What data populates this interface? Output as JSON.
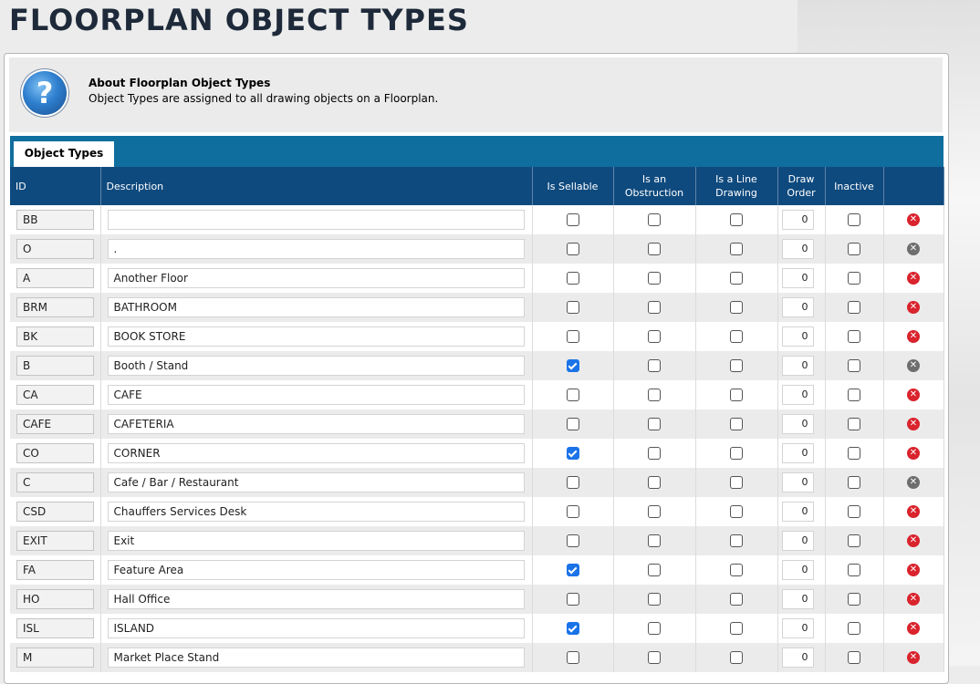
{
  "page": {
    "title": "FLOORPLAN OBJECT TYPES"
  },
  "info": {
    "title": "About Floorplan Object Types",
    "text": "Object Types are assigned to all drawing objects on a Floorplan.",
    "icon": "help-icon"
  },
  "tabs": [
    {
      "label": "Object Types",
      "active": true
    }
  ],
  "colors": {
    "tabbar": "#0f6e9e",
    "header": "#0f4a7e",
    "checked": "#1a73e8",
    "delete": "#d9232d",
    "delete_disabled": "#6e6e6e"
  },
  "table": {
    "columns": {
      "id": "ID",
      "description": "Description",
      "is_sellable": "Is Sellable",
      "is_obstruction_1": "Is an",
      "is_obstruction_2": "Obstruction",
      "is_line_1": "Is a Line",
      "is_line_2": "Drawing",
      "draw_order_1": "Draw",
      "draw_order_2": "Order",
      "inactive": "Inactive"
    },
    "rows": [
      {
        "id": "BB",
        "description": "",
        "sellable": false,
        "obstruction": false,
        "line": false,
        "order": "0",
        "inactive": false,
        "deletable": true
      },
      {
        "id": "O",
        "description": ".",
        "sellable": false,
        "obstruction": false,
        "line": false,
        "order": "0",
        "inactive": false,
        "deletable": false
      },
      {
        "id": "A",
        "description": "Another Floor",
        "sellable": false,
        "obstruction": false,
        "line": false,
        "order": "0",
        "inactive": false,
        "deletable": true
      },
      {
        "id": "BRM",
        "description": "BATHROOM",
        "sellable": false,
        "obstruction": false,
        "line": false,
        "order": "0",
        "inactive": false,
        "deletable": true
      },
      {
        "id": "BK",
        "description": "BOOK STORE",
        "sellable": false,
        "obstruction": false,
        "line": false,
        "order": "0",
        "inactive": false,
        "deletable": true
      },
      {
        "id": "B",
        "description": "Booth / Stand",
        "sellable": true,
        "obstruction": false,
        "line": false,
        "order": "0",
        "inactive": false,
        "deletable": false
      },
      {
        "id": "CA",
        "description": "CAFE",
        "sellable": false,
        "obstruction": false,
        "line": false,
        "order": "0",
        "inactive": false,
        "deletable": true
      },
      {
        "id": "CAFE",
        "description": "CAFETERIA",
        "sellable": false,
        "obstruction": false,
        "line": false,
        "order": "0",
        "inactive": false,
        "deletable": true
      },
      {
        "id": "CO",
        "description": "CORNER",
        "sellable": true,
        "obstruction": false,
        "line": false,
        "order": "0",
        "inactive": false,
        "deletable": true
      },
      {
        "id": "C",
        "description": "Cafe / Bar / Restaurant",
        "sellable": false,
        "obstruction": false,
        "line": false,
        "order": "0",
        "inactive": false,
        "deletable": false
      },
      {
        "id": "CSD",
        "description": "Chauffers Services Desk",
        "sellable": false,
        "obstruction": false,
        "line": false,
        "order": "0",
        "inactive": false,
        "deletable": true
      },
      {
        "id": "EXIT",
        "description": "Exit",
        "sellable": false,
        "obstruction": false,
        "line": false,
        "order": "0",
        "inactive": false,
        "deletable": true
      },
      {
        "id": "FA",
        "description": "Feature Area",
        "sellable": true,
        "obstruction": false,
        "line": false,
        "order": "0",
        "inactive": false,
        "deletable": true
      },
      {
        "id": "HO",
        "description": "Hall Office",
        "sellable": false,
        "obstruction": false,
        "line": false,
        "order": "0",
        "inactive": false,
        "deletable": true
      },
      {
        "id": "ISL",
        "description": "ISLAND",
        "sellable": true,
        "obstruction": false,
        "line": false,
        "order": "0",
        "inactive": false,
        "deletable": true
      },
      {
        "id": "M",
        "description": "Market Place Stand",
        "sellable": false,
        "obstruction": false,
        "line": false,
        "order": "0",
        "inactive": false,
        "deletable": true
      }
    ]
  }
}
